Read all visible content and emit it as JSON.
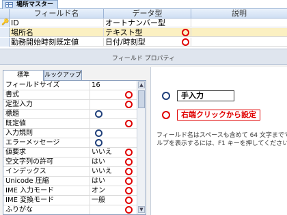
{
  "tab": {
    "title": "場所マスター",
    "icon": "table-icon"
  },
  "grid": {
    "headers": {
      "field_name": "フィールド名",
      "data_type": "データ型",
      "description": "説明"
    },
    "rows": [
      {
        "field": "ID",
        "type": "オートナンバー型",
        "key": true,
        "marker": ""
      },
      {
        "field": "場所名",
        "type": "テキスト型",
        "key": false,
        "marker": "red"
      },
      {
        "field": "勤務開始時刻既定値",
        "type": "日付/時刻型",
        "key": false,
        "marker": "red"
      }
    ]
  },
  "property_band": {
    "label": "フィールド プロパティ"
  },
  "prop_tabs": {
    "general": "標準",
    "lookup": "ルックアップ"
  },
  "properties": [
    {
      "label": "フィールドサイズ",
      "value": "16",
      "marker": ""
    },
    {
      "label": "書式",
      "value": "",
      "marker": "red"
    },
    {
      "label": "定型入力",
      "value": "",
      "marker": "red"
    },
    {
      "label": "標題",
      "value": "",
      "marker": "blue"
    },
    {
      "label": "既定値",
      "value": "",
      "marker": "red"
    },
    {
      "label": "入力規則",
      "value": "",
      "marker": "blue"
    },
    {
      "label": "エラーメッセージ",
      "value": "",
      "marker": "blue"
    },
    {
      "label": "値要求",
      "value": "いいえ",
      "marker": "red"
    },
    {
      "label": "空文字列の許可",
      "value": "はい",
      "marker": "red"
    },
    {
      "label": "インデックス",
      "value": "いいえ",
      "marker": "red"
    },
    {
      "label": "Unicode 圧縮",
      "value": "はい",
      "marker": "red"
    },
    {
      "label": "IME 入力モード",
      "value": "オン",
      "marker": "red"
    },
    {
      "label": "IME 変換モード",
      "value": "一般",
      "marker": "red"
    },
    {
      "label": "ふりがな",
      "value": "",
      "marker": "red"
    }
  ],
  "legend": {
    "blue_label": "手入力",
    "red_label": "右端クリックから設定",
    "blue_color": "#1f3f7a",
    "red_color": "#e00000"
  },
  "hint": {
    "line1": "フィールド名はスペースも含めて 64 文字までで",
    "line2": "ルプを表示するには、F1 キーを押してください"
  }
}
